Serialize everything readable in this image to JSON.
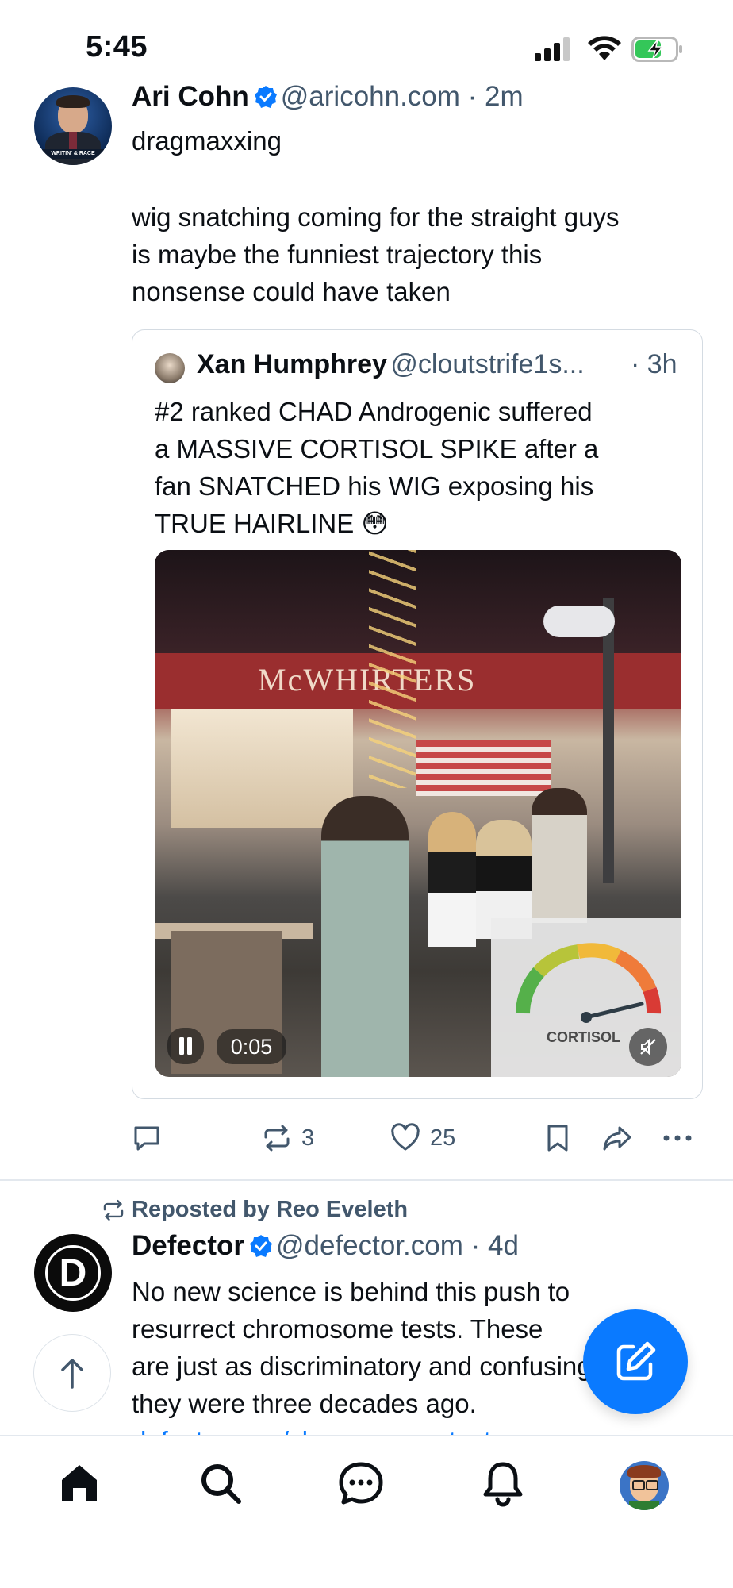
{
  "status_bar": {
    "time": "5:45"
  },
  "post1": {
    "author_name": "Ari Cohn",
    "handle_time": "@aricohn.com · 2m",
    "text_line1": "dragmaxxing",
    "text_lines": [
      "wig snatching coming for the straight guys",
      "is maybe the funniest trajectory this",
      "nonsense could have taken"
    ],
    "quote": {
      "author_name": "Xan Humphrey",
      "handle": "@cloutstrife1s...",
      "time": "· 3h",
      "text_lines": [
        "#2 ranked CHAD Androgenic suffered",
        "a MASSIVE CORTISOL SPIKE after a",
        "fan SNATCHED his WIG exposing his",
        "TRUE HAIRLINE 😳"
      ],
      "video": {
        "sign_text": "McWHIRTERS",
        "gauge_label": "CORTISOL",
        "timestamp": "0:05"
      }
    },
    "actions": {
      "reposts": "3",
      "likes": "25"
    }
  },
  "post2": {
    "reposted_by": "Reposted by Reo Eveleth",
    "author_name": "Defector",
    "handle_time": "@defector.com · 4d",
    "text_lines": [
      "No new science is behind this push to",
      "resurrect chromosome tests. These",
      "are just as discriminatory and confusing as",
      "they were three decades ago."
    ],
    "link_partial": "defector.com/chromosome-test..."
  },
  "colors": {
    "accent": "#0a7aff",
    "muted": "#42576c",
    "battery_green": "#34c759"
  },
  "icons": [
    "signal-icon",
    "wifi-icon",
    "battery-icon",
    "verified-icon",
    "pause-icon",
    "mute-icon",
    "reply-icon",
    "repost-icon",
    "like-icon",
    "bookmark-icon",
    "share-icon",
    "more-icon",
    "home-icon",
    "search-icon",
    "chat-icon",
    "bell-icon",
    "compose-icon",
    "arrow-up-icon"
  ]
}
